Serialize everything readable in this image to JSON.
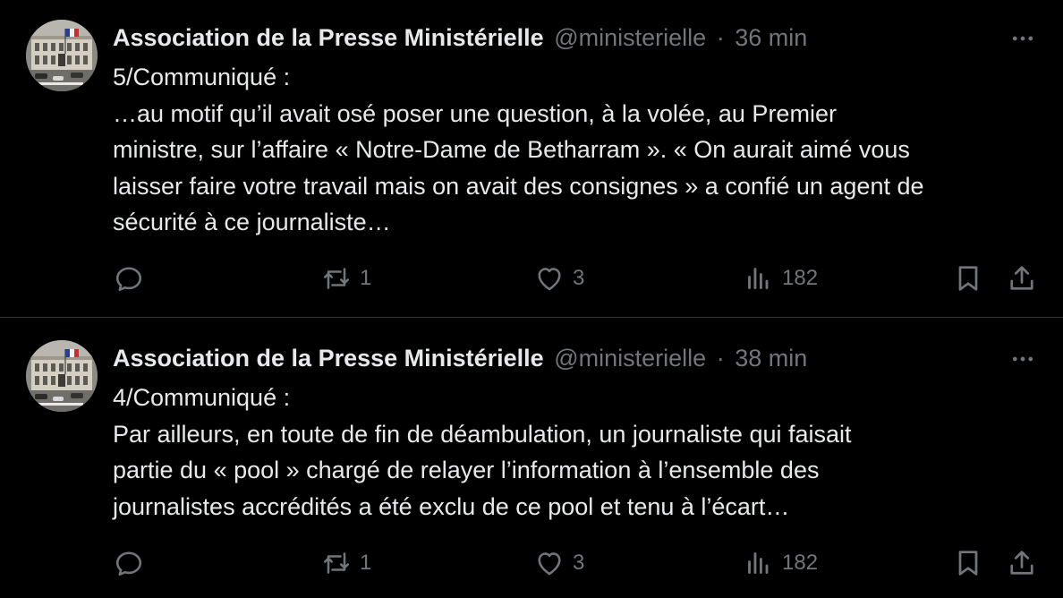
{
  "tweets": [
    {
      "author_name": "Association de la Presse Ministérielle",
      "handle": "@ministerielle",
      "separator": "·",
      "time": "36 min",
      "lines": [
        "5/Communiqué :",
        "…au motif qu’il avait osé poser une question, à la volée, au Premier",
        "ministre, sur l’affaire « Notre-Dame de Betharram ». « On aurait aimé vous",
        "laisser faire votre travail mais on avait des consignes » a confié un agent de",
        "sécurité à ce journaliste…"
      ],
      "reposts": "1",
      "likes": "3",
      "views": "182"
    },
    {
      "author_name": "Association de la Presse Ministérielle",
      "handle": "@ministerielle",
      "separator": "·",
      "time": "38 min",
      "lines": [
        "4/Communiqué :",
        "Par ailleurs, en toute de fin de déambulation, un journaliste qui faisait",
        "partie du « pool » chargé de relayer l’information à l’ensemble des",
        "journalistes accrédités a été exclu de ce pool et tenu à l’écart…"
      ],
      "reposts": "1",
      "likes": "3",
      "views": "182"
    }
  ],
  "icons": {
    "reply": "reply-icon",
    "repost": "repost-icon",
    "like": "heart-icon",
    "views": "views-icon",
    "bookmark": "bookmark-icon",
    "share": "share-icon",
    "more": "more-icon",
    "avatar": "building-with-flag"
  },
  "colors": {
    "background": "#000000",
    "text": "#e7e9ea",
    "secondary": "#71767b",
    "divider": "#2f3336"
  }
}
